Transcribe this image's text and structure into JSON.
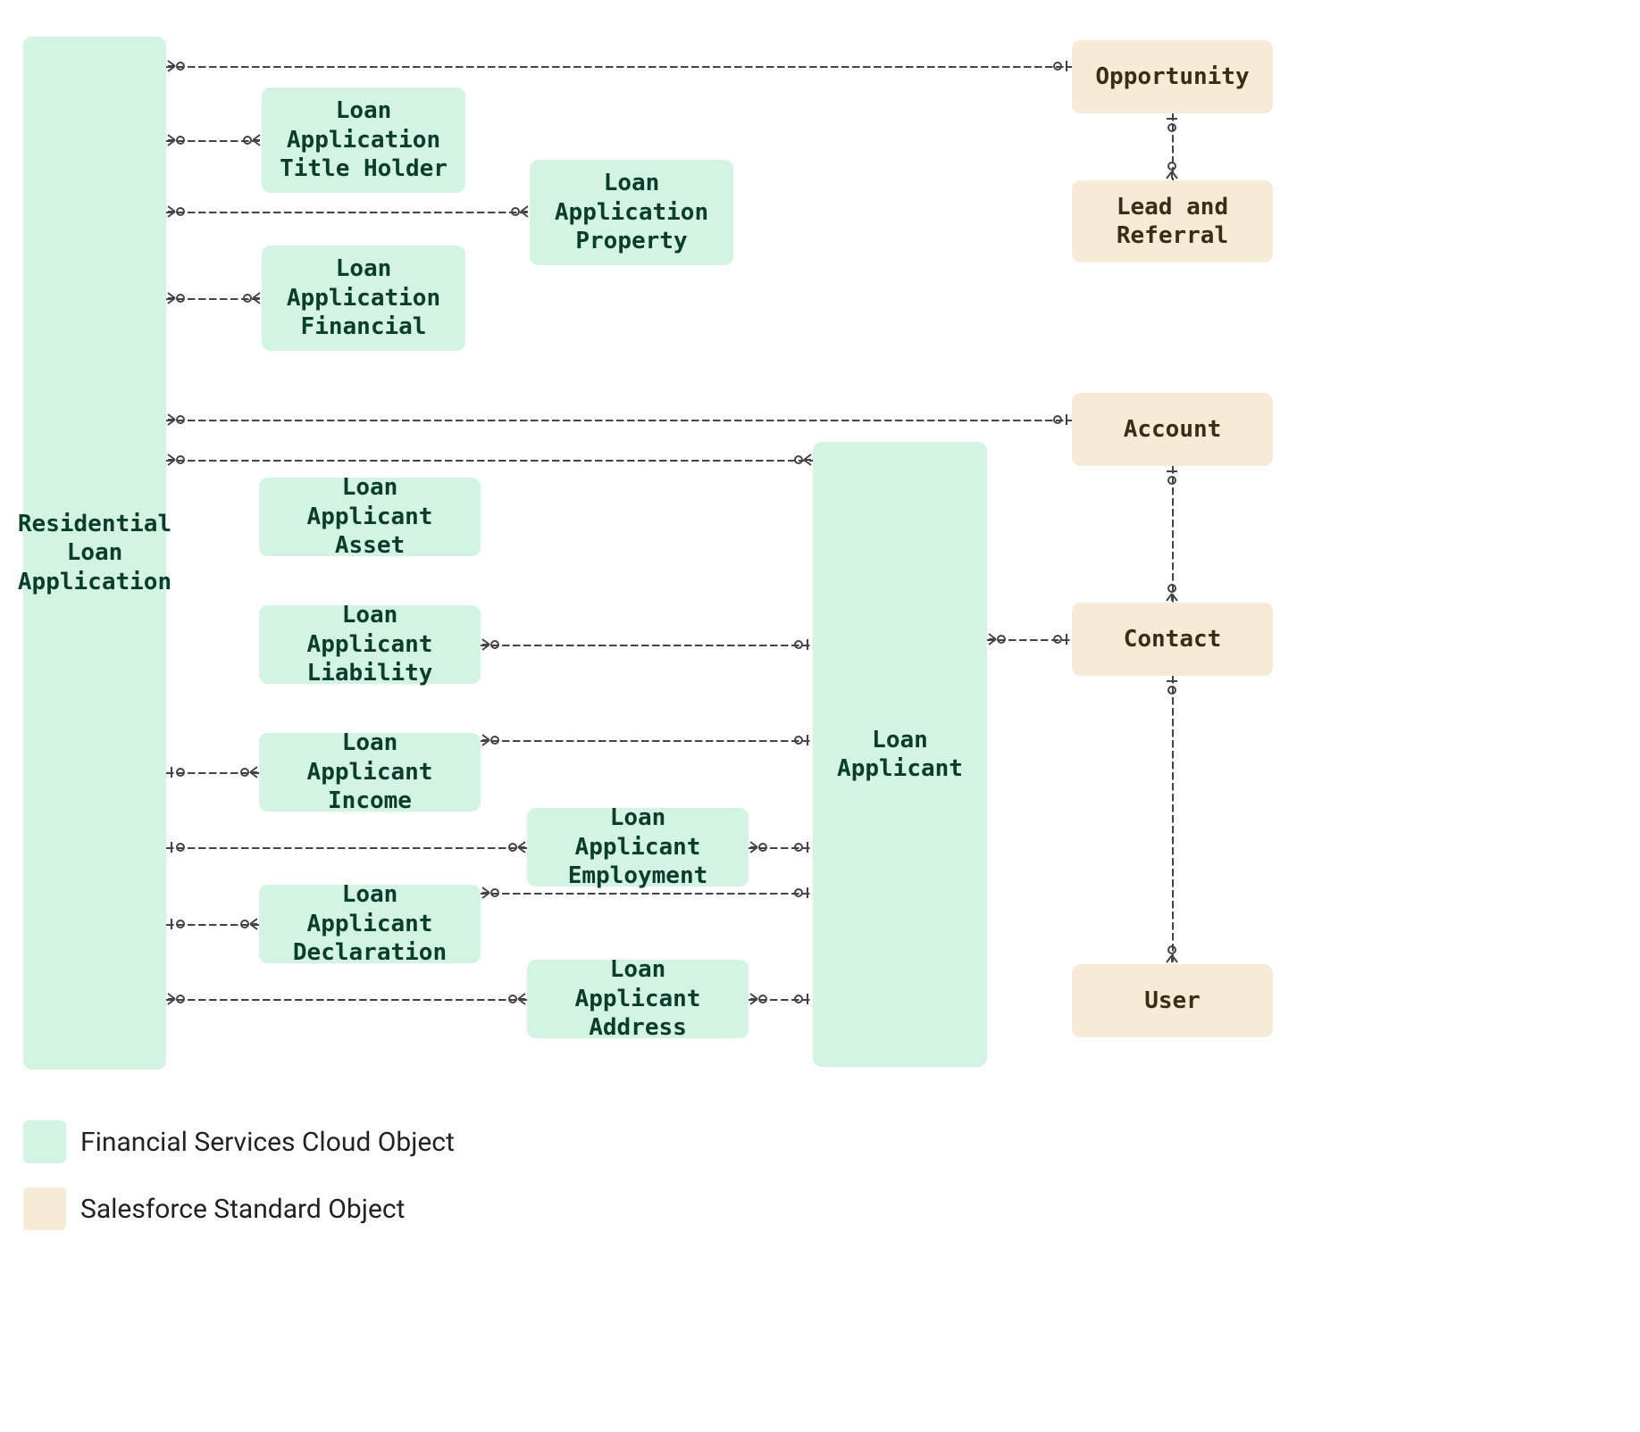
{
  "legend": {
    "fsc": "Financial Services Cloud Object",
    "std": "Salesforce Standard Object"
  },
  "entities": {
    "rla": {
      "label": "Residential\nLoan\nApplication"
    },
    "title": {
      "label": "Loan\nApplication\nTitle Holder"
    },
    "prop": {
      "label": "Loan\nApplication\nProperty"
    },
    "fin": {
      "label": "Loan\nApplication\nFinancial"
    },
    "asset": {
      "label": "Loan Applicant\nAsset"
    },
    "liab": {
      "label": "Loan Applicant\nLiability"
    },
    "inc": {
      "label": "Loan Applicant\nIncome"
    },
    "emp": {
      "label": "Loan Applicant\nEmployment"
    },
    "decl": {
      "label": "Loan Applicant\nDeclaration"
    },
    "addr": {
      "label": "Loan Applicant\nAddress"
    },
    "appl": {
      "label": "Loan\nApplicant"
    },
    "opp": {
      "label": "Opportunity"
    },
    "lead": {
      "label": "Lead and\nReferral"
    },
    "acct": {
      "label": "Account"
    },
    "cont": {
      "label": "Contact"
    },
    "user": {
      "label": "User"
    }
  }
}
